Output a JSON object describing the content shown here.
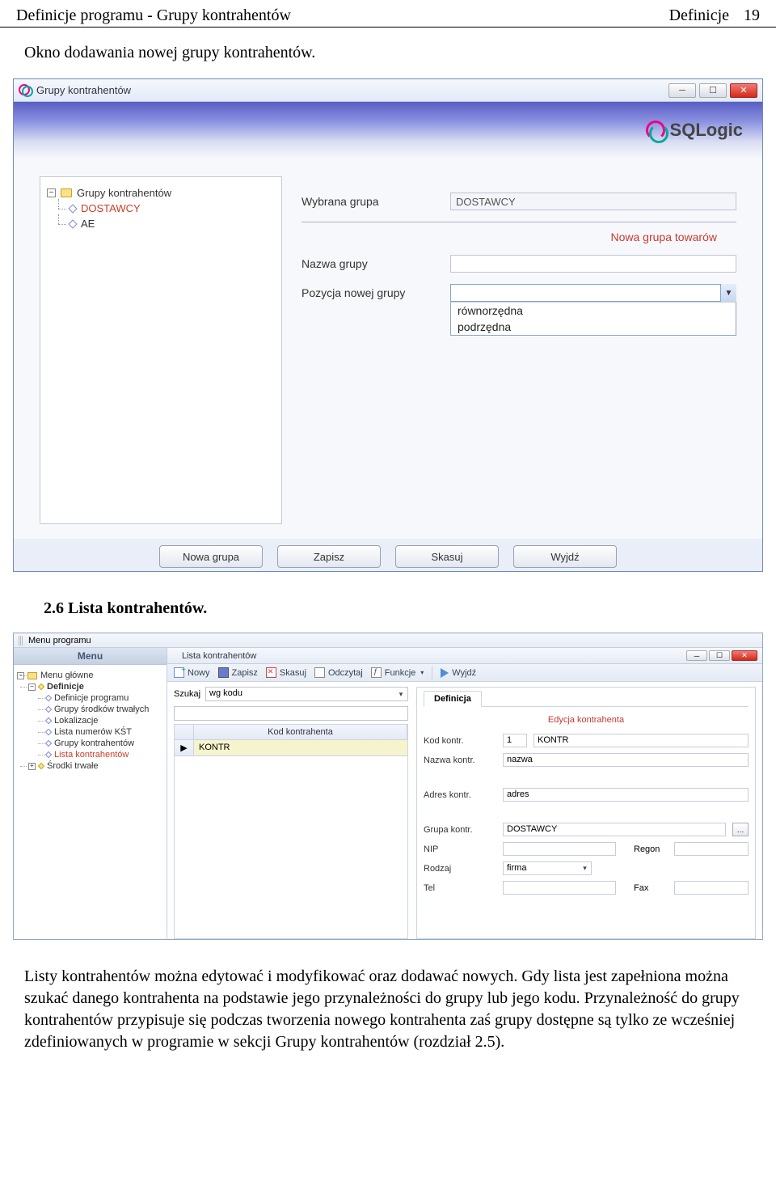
{
  "page_header": {
    "left": "Definicje programu - Grupy kontrahentów",
    "right_definicje": "Definicje",
    "page_number": "19"
  },
  "intro": "Okno dodawania nowej grupy kontrahentów.",
  "section_2_6": "2.6 Lista kontrahentów.",
  "body_para": "Listy kontrahentów można edytować i modyfikować oraz dodawać nowych. Gdy lista jest zapełniona można szukać danego kontrahenta na podstawie jego przynależności do grupy lub jego kodu. Przynależność do grupy kontrahentów przypisuje się podczas tworzenia nowego kontrahenta zaś grupy dostępne są tylko ze wcześniej zdefiniowanych w programie w sekcji Grupy kontrahentów (rozdział 2.5).",
  "win1": {
    "title": "Grupy kontrahentów",
    "brand": "SQLogic",
    "tree": {
      "root": "Grupy kontrahentów",
      "items": [
        "DOSTAWCY",
        "AE"
      ]
    },
    "form": {
      "selected_label": "Wybrana grupa",
      "selected_value": "DOSTAWCY",
      "section_title": "Nowa grupa towarów",
      "name_label": "Nazwa grupy",
      "pos_label": "Pozycja nowej grupy",
      "pos_options": [
        "równorzędna",
        "podrzędna"
      ]
    },
    "buttons": {
      "new": "Nowa grupa",
      "save": "Zapisz",
      "delete": "Skasuj",
      "exit": "Wyjdź"
    }
  },
  "win2": {
    "menu_bar": "Menu programu",
    "left_panel": {
      "header": "Menu",
      "root": "Menu główne",
      "definicje": "Definicje",
      "items": [
        "Definicje programu",
        "Grupy środków trwałych",
        "Lokalizacje",
        "Lista numerów KŚT",
        "Grupy kontrahentów",
        "Lista kontrahentów"
      ],
      "srodki": "Środki trwałe"
    },
    "right_panel": {
      "title": "Lista kontrahentów",
      "toolbar": {
        "new": "Nowy",
        "save": "Zapisz",
        "delete": "Skasuj",
        "refresh": "Odczytaj",
        "func": "Funkcje",
        "exit": "Wyjdź"
      },
      "search": {
        "label": "Szukaj",
        "value": "wg kodu"
      },
      "grid": {
        "col_header": "Kod kontrahenta",
        "row_marker": "▶",
        "row0": "KONTR"
      },
      "detail": {
        "tab": "Definicja",
        "section_title": "Edycja kontrahenta",
        "fields": {
          "kod_label": "Kod kontr.",
          "kod_num": "1",
          "kod_val": "KONTR",
          "nazwa_label": "Nazwa kontr.",
          "nazwa_val": "nazwa",
          "adres_label": "Adres kontr.",
          "adres_val": "adres",
          "grupa_label": "Grupa kontr.",
          "grupa_val": "DOSTAWCY",
          "nip_label": "NIP",
          "regon_label": "Regon",
          "rodzaj_label": "Rodzaj",
          "rodzaj_val": "firma",
          "tel_label": "Tel",
          "fax_label": "Fax"
        }
      }
    }
  }
}
